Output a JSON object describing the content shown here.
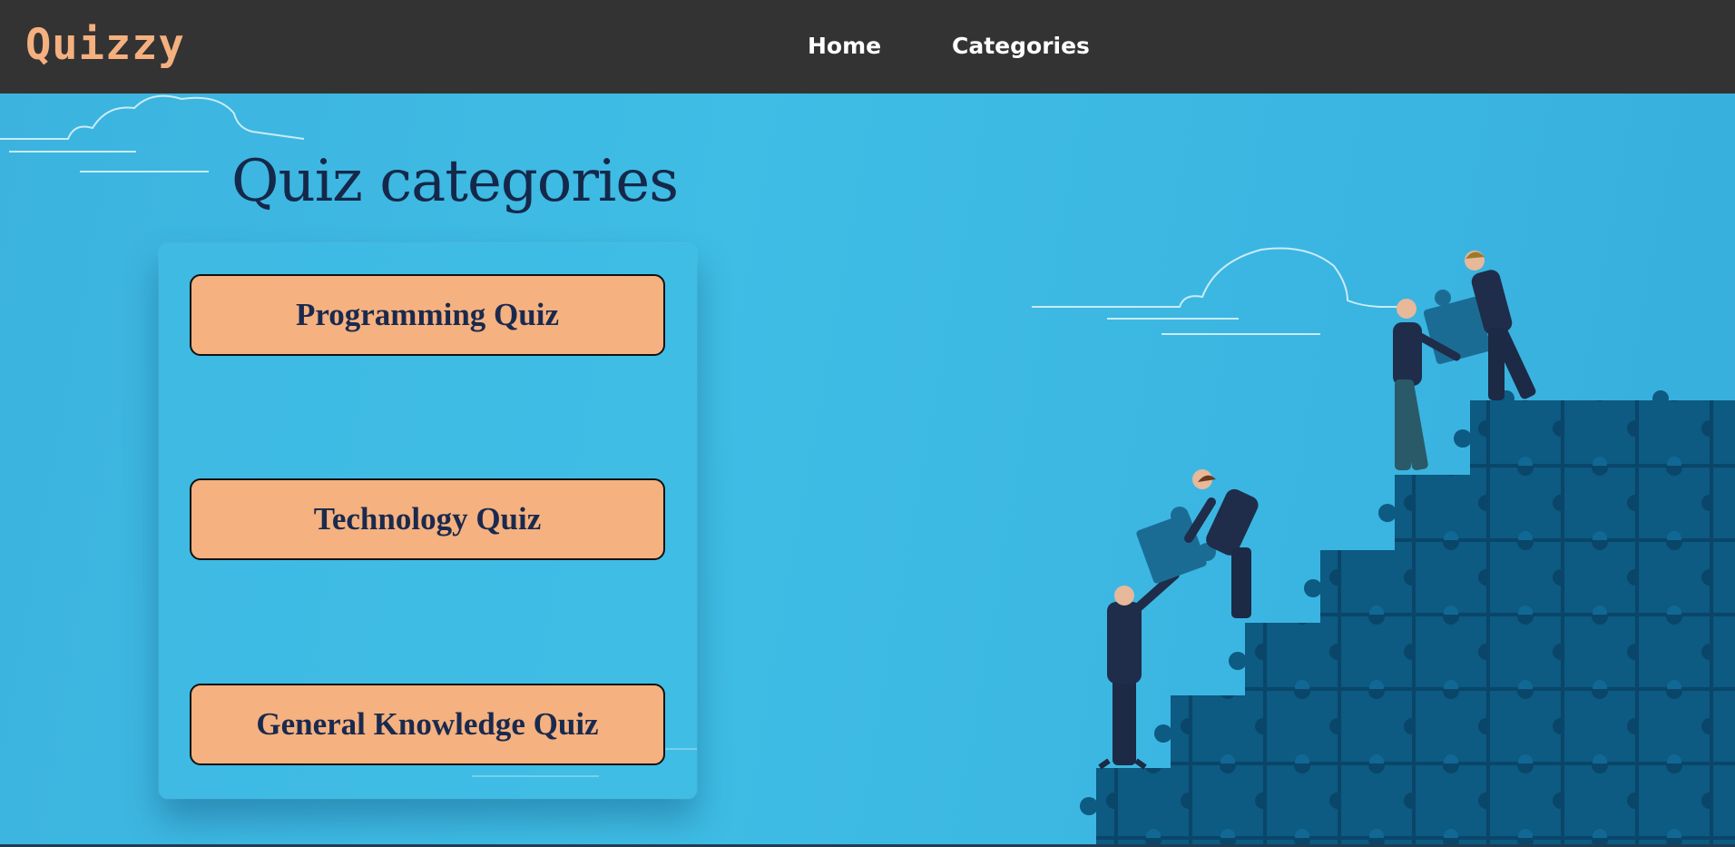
{
  "navbar": {
    "logo": "Quizzy",
    "links": [
      {
        "label": "Home"
      },
      {
        "label": "Categories"
      }
    ]
  },
  "main": {
    "heading": "Quiz categories",
    "quizzes": [
      {
        "label": "Programming Quiz"
      },
      {
        "label": "Technology Quiz"
      },
      {
        "label": "General Knowledge Quiz"
      }
    ]
  },
  "colors": {
    "navbar_bg": "#333333",
    "logo": "#f5b07f",
    "hero_bg": "#3fbde5",
    "heading": "#15284a",
    "button_bg": "#f5b17f",
    "button_text": "#1a2a4e",
    "puzzle": "#0e5a80"
  },
  "illustration": {
    "icon": "puzzle-teamwork-illustration"
  }
}
